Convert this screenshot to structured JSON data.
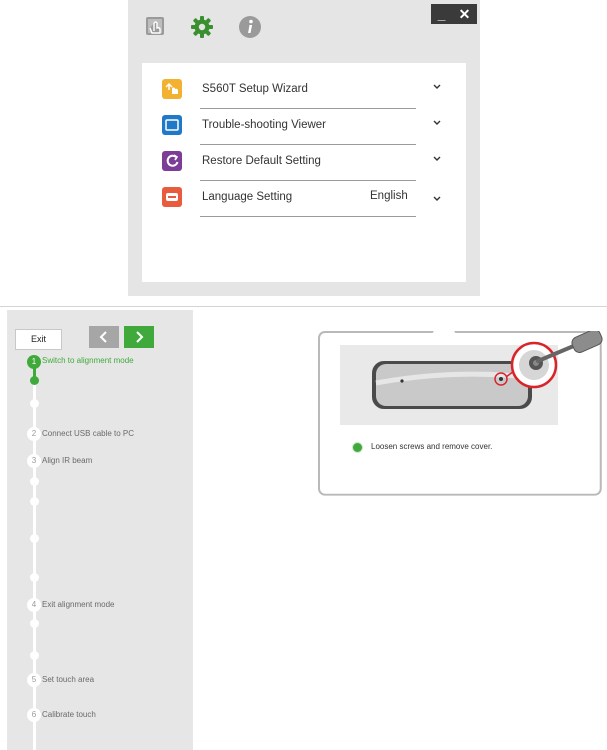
{
  "settings_window": {
    "icons": [
      "touch-setup-icon",
      "gear-icon",
      "info-icon"
    ],
    "window_controls": {
      "minimize": "_",
      "close": "✕"
    },
    "menu_items": [
      {
        "label": "S560T Setup Wizard",
        "icon": "setup-wizard-icon",
        "color": "#f3b131"
      },
      {
        "label": "Trouble-shooting Viewer",
        "icon": "troubleshoot-viewer-icon",
        "color": "#1f79c8"
      },
      {
        "label": "Restore Default Setting",
        "icon": "restore-icon",
        "color": "#7b3d98"
      },
      {
        "label": "Language Setting",
        "icon": "language-icon",
        "color": "#e85b3c",
        "value": "English"
      }
    ]
  },
  "wizard": {
    "exit_label": "Exit",
    "nav": {
      "prev": "previous-icon",
      "next": "next-icon"
    },
    "steps": [
      {
        "number": "1",
        "label": "Switch to alignment mode",
        "active": true
      },
      {
        "number": "2",
        "label": "Connect USB cable to PC",
        "active": false
      },
      {
        "number": "3",
        "label": "Align IR beam",
        "active": false
      },
      {
        "number": "4",
        "label": "Exit alignment mode",
        "active": false
      },
      {
        "number": "5",
        "label": "Set touch area",
        "active": false
      },
      {
        "number": "6",
        "label": "Calibrate touch",
        "active": false
      }
    ],
    "instruction": "Loosen screws and remove cover."
  },
  "colors": {
    "accent_green": "#3faa3b",
    "sidebar_bg": "#e6e6e6",
    "nav_gray": "#a6a6a6"
  }
}
